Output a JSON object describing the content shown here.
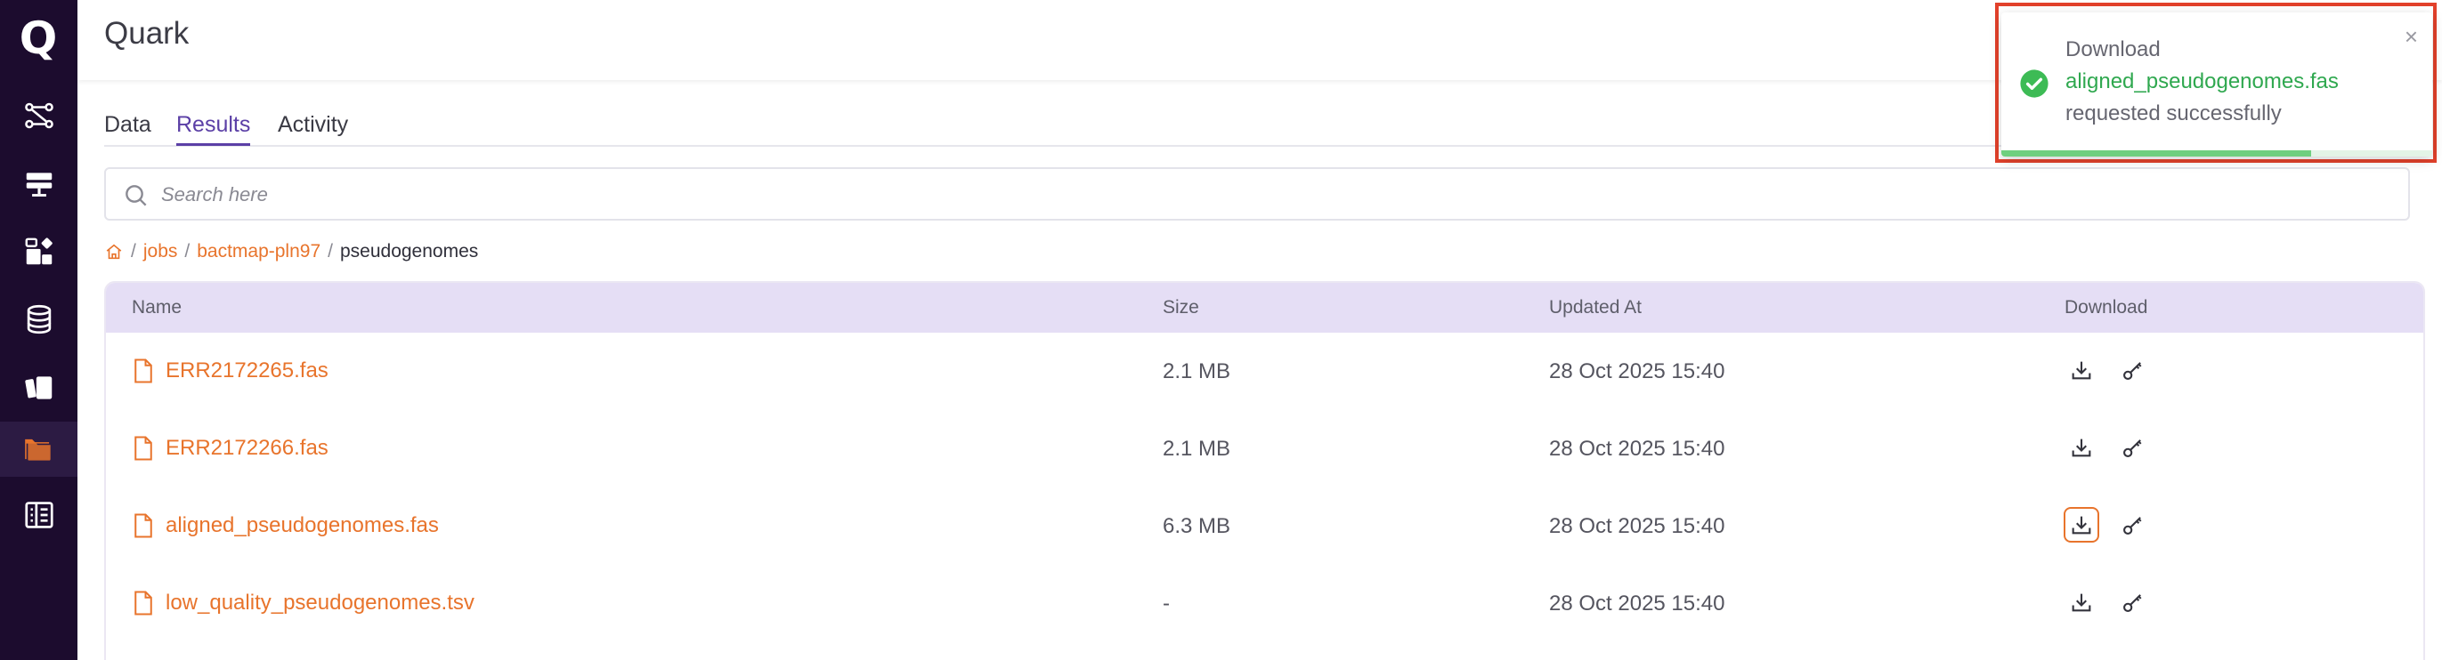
{
  "app": {
    "title": "Quark",
    "logo_letter": "Q"
  },
  "sidebar": {
    "items": [
      {
        "icon": "workflow-icon",
        "active": false
      },
      {
        "icon": "server-icon",
        "active": false
      },
      {
        "icon": "apps-icon",
        "active": false
      },
      {
        "icon": "database-icon",
        "active": false
      },
      {
        "icon": "cards-icon",
        "active": false
      },
      {
        "icon": "folder-icon",
        "active": true
      },
      {
        "icon": "list-panel-icon",
        "active": false
      }
    ]
  },
  "tabs": [
    {
      "label": "Data",
      "active": false
    },
    {
      "label": "Results",
      "active": true
    },
    {
      "label": "Activity",
      "active": false
    }
  ],
  "search": {
    "placeholder": "Search here",
    "value": ""
  },
  "breadcrumb": {
    "home_icon": "home-icon",
    "items": [
      {
        "label": "jobs",
        "link": true
      },
      {
        "label": "bactmap-pln97",
        "link": true
      },
      {
        "label": "pseudogenomes",
        "link": false
      }
    ],
    "separator": "/"
  },
  "table": {
    "columns": [
      "Name",
      "Size",
      "Updated At",
      "Download"
    ],
    "rows": [
      {
        "name": "ERR2172265.fas",
        "size": "2.1 MB",
        "updated": "28 Oct 2025 15:40"
      },
      {
        "name": "ERR2172266.fas",
        "size": "2.1 MB",
        "updated": "28 Oct 2025 15:40"
      },
      {
        "name": "aligned_pseudogenomes.fas",
        "size": "6.3 MB",
        "updated": "28 Oct 2025 15:40",
        "focused": true
      },
      {
        "name": "low_quality_pseudogenomes.tsv",
        "size": "-",
        "updated": "28 Oct 2025 15:40"
      }
    ]
  },
  "toast": {
    "line1": "Download",
    "file": "aligned_pseudogenomes.fas",
    "line3": "requested successfully",
    "close_glyph": "×",
    "progress": 0.72,
    "colors": {
      "success": "#2fa84f",
      "highlight_border": "#e2412b"
    }
  },
  "colors": {
    "sidebar_bg": "#1c0c2e",
    "accent_orange": "#e8742c",
    "accent_purple": "#5b3fa6",
    "table_header_bg": "#e5def5"
  }
}
